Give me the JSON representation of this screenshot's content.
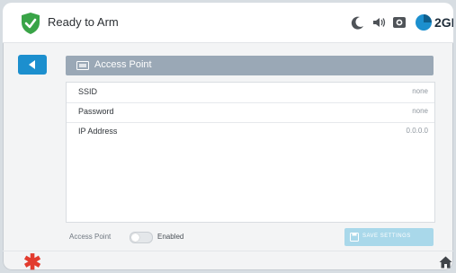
{
  "statusbar": {
    "status_text": "Ready to Arm",
    "brand": "2GIG",
    "icons": [
      "shield-check-icon",
      "moon-icon",
      "volume-icon",
      "camera-icon",
      "brand-logo-icon"
    ]
  },
  "nav": {
    "back_icon": "back-arrow-icon"
  },
  "header": {
    "title": "Access Point",
    "icon": "access-point-icon"
  },
  "fields": [
    {
      "label": "SSID",
      "value": "none"
    },
    {
      "label": "Password",
      "value": "none"
    },
    {
      "label": "IP Address",
      "value": "0.0.0.0"
    }
  ],
  "toggle": {
    "label": "Access Point",
    "state_label": "Enabled",
    "on": false
  },
  "save": {
    "label": "SAVE SETTINGS",
    "enabled": false
  },
  "footer": {
    "emergency_icon": "emergency-asterisk-icon",
    "home_icon": "home-icon"
  },
  "colors": {
    "accent": "#1c8fce",
    "header": "#9aa8b6",
    "ready": "#39a447",
    "emergency": "#e23b2e",
    "save_disabled": "#a9d8ea"
  }
}
